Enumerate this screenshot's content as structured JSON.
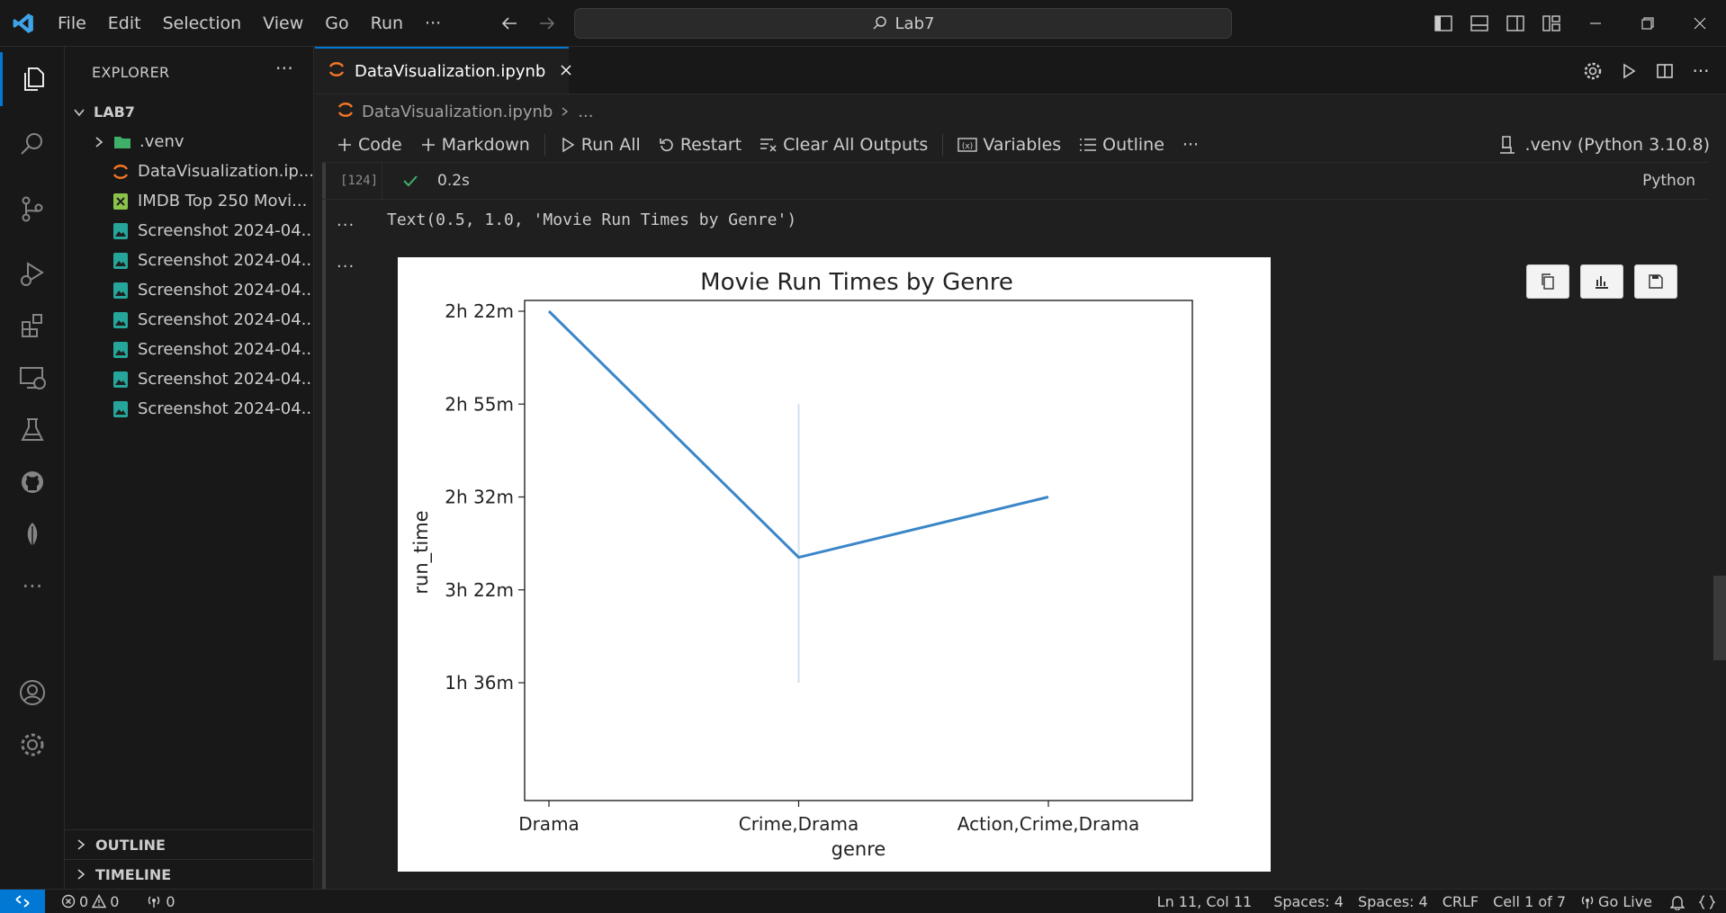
{
  "menu": [
    "File",
    "Edit",
    "Selection",
    "View",
    "Go",
    "Run",
    "···"
  ],
  "search": {
    "text": "Lab7"
  },
  "sidebar": {
    "title": "EXPLORER",
    "root": "LAB7",
    "items": [
      {
        "label": ".venv",
        "icon": "folder-icon"
      },
      {
        "label": "DataVisualization.ip...",
        "icon": "jupyter-icon"
      },
      {
        "label": "IMDB Top 250 Movi...",
        "icon": "excel-icon"
      },
      {
        "label": "Screenshot 2024-04...",
        "icon": "image-icon"
      },
      {
        "label": "Screenshot 2024-04...",
        "icon": "image-icon"
      },
      {
        "label": "Screenshot 2024-04...",
        "icon": "image-icon"
      },
      {
        "label": "Screenshot 2024-04...",
        "icon": "image-icon"
      },
      {
        "label": "Screenshot 2024-04...",
        "icon": "image-icon"
      },
      {
        "label": "Screenshot 2024-04...",
        "icon": "image-icon"
      },
      {
        "label": "Screenshot 2024-04...",
        "icon": "image-icon"
      }
    ],
    "outline": "OUTLINE",
    "timeline": "TIMELINE"
  },
  "tab": {
    "label": "DataVisualization.ipynb"
  },
  "breadcrumb": {
    "file": "DataVisualization.ipynb",
    "rest": "..."
  },
  "toolbar": {
    "code": "Code",
    "markdown": "Markdown",
    "run_all": "Run All",
    "restart": "Restart",
    "clear": "Clear All Outputs",
    "variables": "Variables",
    "outline": "Outline",
    "more": "···",
    "kernel": ".venv (Python 3.10.8)"
  },
  "cell": {
    "exec_count": "[124]",
    "time": "0.2s",
    "language": "Python",
    "dots": "···",
    "output_text": "Text(0.5, 1.0, 'Movie Run Times by Genre')"
  },
  "chart_data": {
    "type": "line",
    "title": "Movie Run Times by Genre",
    "xlabel": "genre",
    "ylabel": "run_time",
    "categories": [
      "Drama",
      "Crime,Drama",
      "Action,Crime,Drama"
    ],
    "y_ticks": [
      "2h 22m",
      "2h 55m",
      "2h 32m",
      "3h 22m",
      "1h 36m"
    ],
    "series": [
      {
        "values": [
          "2h 22m",
          "between 2h 32m and 3h 22m",
          "2h 32m"
        ],
        "y_positions": [
          0,
          2.65,
          2
        ]
      }
    ],
    "error_bar": {
      "category": "Crime,Drama",
      "from": "2h 55m",
      "to": "1h 36m"
    },
    "color": "#3a86c8"
  },
  "status": {
    "errors": "0",
    "warnings": "0",
    "ports": "0",
    "position": "Ln 11, Col 11",
    "spaces1": "Spaces: 4",
    "spaces2": "Spaces: 4",
    "eol": "CRLF",
    "cell": "Cell 1 of 7",
    "golive": "Go Live"
  }
}
